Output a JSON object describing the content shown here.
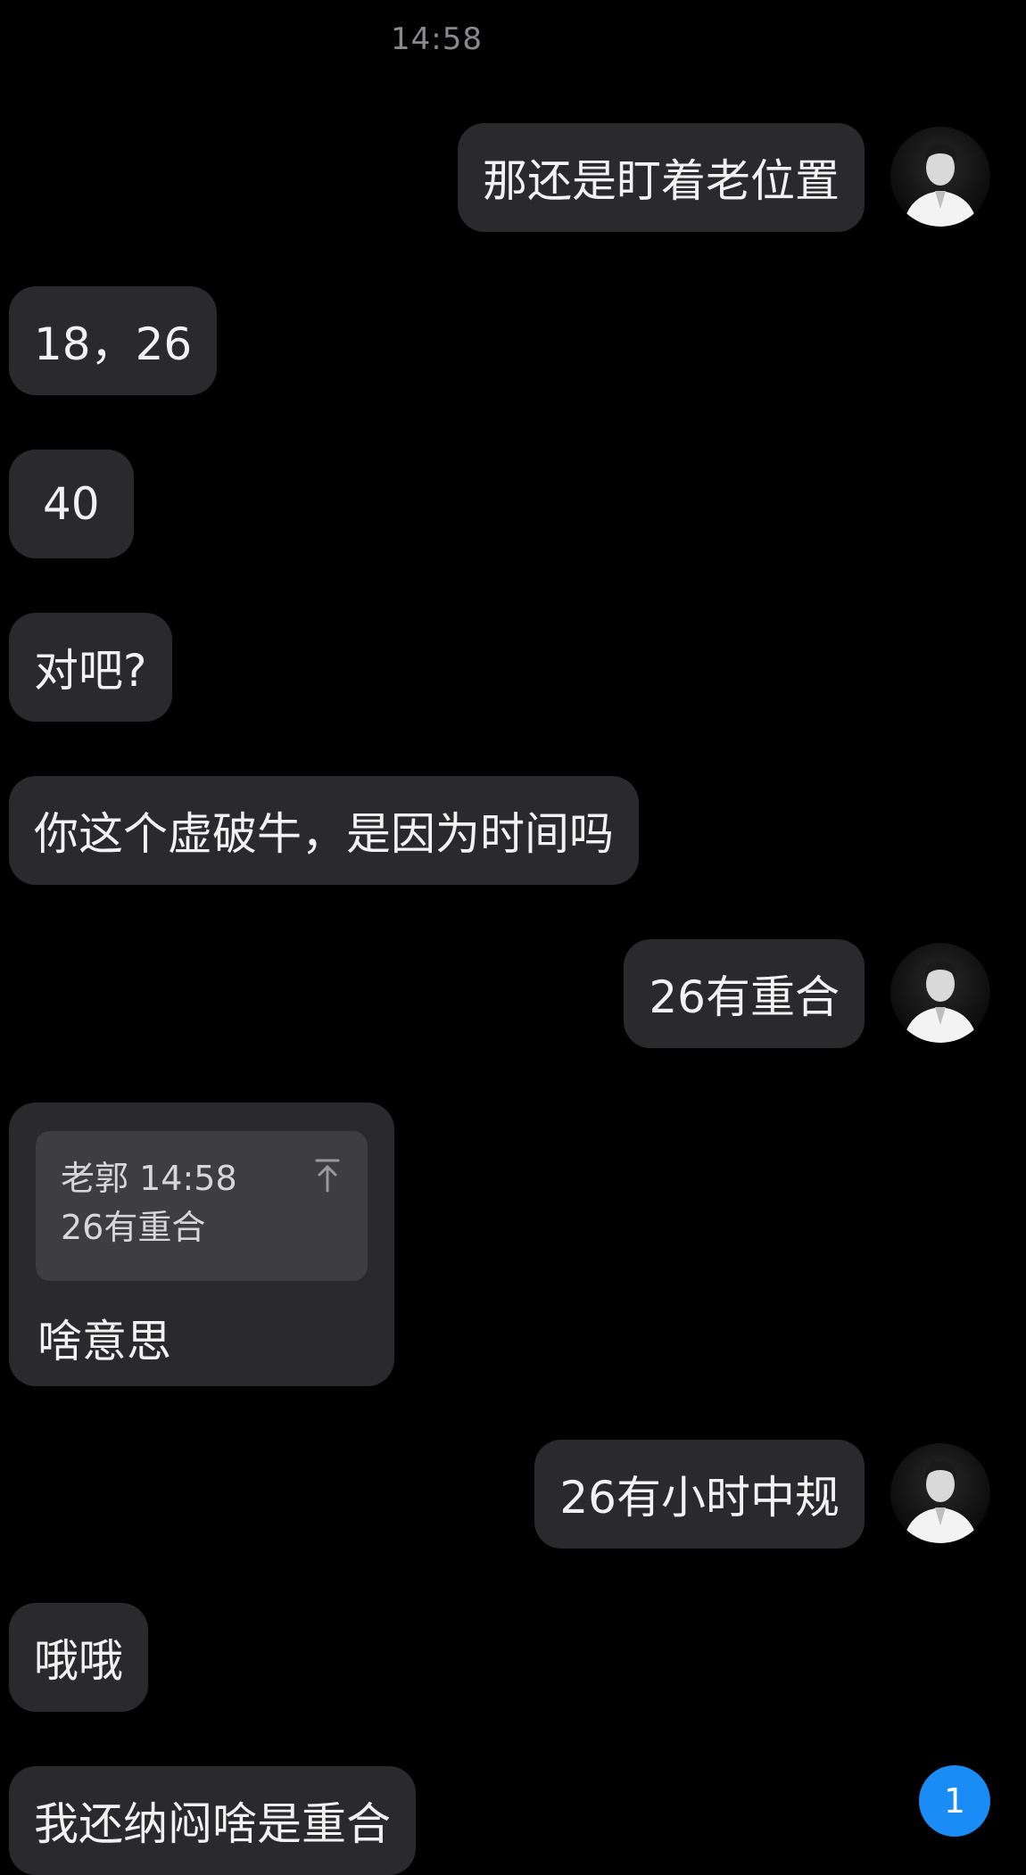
{
  "chat": {
    "time": "14:58",
    "messages": [
      {
        "side": "out",
        "text": "那还是盯着老位置"
      },
      {
        "side": "in",
        "text": "18，26"
      },
      {
        "side": "in",
        "text": "40"
      },
      {
        "side": "in",
        "text": "对吧?"
      },
      {
        "side": "in",
        "text": "你这个虚破牛，是因为时间吗"
      },
      {
        "side": "out",
        "text": "26有重合"
      },
      {
        "side": "in",
        "text": "啥意思"
      },
      {
        "side": "out",
        "text": "26有小时中规"
      },
      {
        "side": "in",
        "text": "哦哦"
      },
      {
        "side": "in",
        "text": "我还纳闷啥是重合"
      }
    ],
    "quote": {
      "sender": "老郭",
      "time": "14:58",
      "text": "26有重合"
    },
    "unread_count": "1"
  },
  "colors": {
    "background": "#000000",
    "bubble": "#2a2a2c",
    "quote_box": "#3e3e41",
    "badge": "#1a8cf5"
  },
  "icons": {
    "avatar": "avatar-photo",
    "quote_jump": "jump-to-top-arrow-icon"
  }
}
